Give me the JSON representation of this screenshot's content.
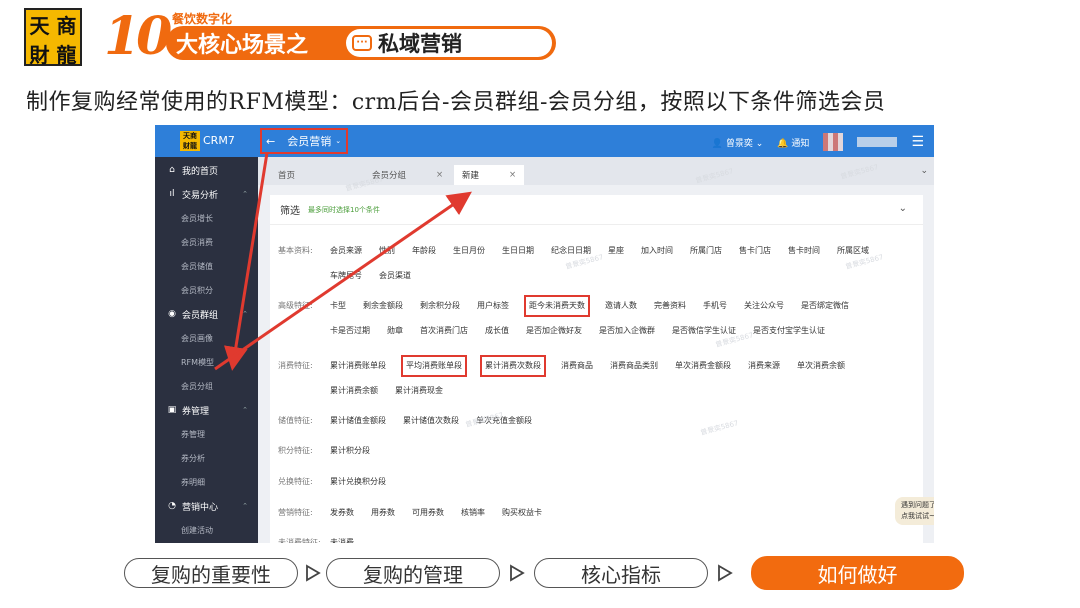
{
  "slide": {
    "logo_chars": [
      "天",
      "商",
      "財",
      "龍"
    ],
    "banner_number": "10",
    "banner_sub": "餐饮数字化",
    "banner_main": "大核心场景之",
    "banner_inner": "私域营销",
    "caption": "制作复购经常使用的RFM模型：crm后台-会员群组-会员分组，按照以下条件筛选会员"
  },
  "app": {
    "logo_text": "天商财龍",
    "name": "CRM7",
    "top_nav": "会员营销",
    "user": "曾景奕",
    "notify": "通知",
    "watermark": "曾景奕5867"
  },
  "sidebar": {
    "items": [
      {
        "label": "我的首页",
        "icon": "home-icon",
        "glyph": "⌂",
        "kind": "top"
      },
      {
        "label": "交易分析",
        "icon": "bar-chart-icon",
        "glyph": "ıl",
        "kind": "top"
      },
      {
        "label": "会员增长",
        "kind": "sub"
      },
      {
        "label": "会员消费",
        "kind": "sub"
      },
      {
        "label": "会员储值",
        "kind": "sub"
      },
      {
        "label": "会员积分",
        "kind": "sub"
      },
      {
        "label": "会员群组",
        "icon": "group-icon",
        "glyph": "◉",
        "kind": "top"
      },
      {
        "label": "会员画像",
        "kind": "sub"
      },
      {
        "label": "RFM模型",
        "kind": "sub"
      },
      {
        "label": "会员分组",
        "kind": "sub"
      },
      {
        "label": "券管理",
        "icon": "coupon-icon",
        "glyph": "▣",
        "kind": "top"
      },
      {
        "label": "券管理",
        "kind": "sub"
      },
      {
        "label": "券分析",
        "kind": "sub"
      },
      {
        "label": "券明细",
        "kind": "sub"
      },
      {
        "label": "营销中心",
        "icon": "pie-icon",
        "glyph": "◔",
        "kind": "top"
      },
      {
        "label": "创建活动",
        "kind": "sub"
      }
    ]
  },
  "tabs": [
    {
      "label": "首页",
      "close": ""
    },
    {
      "label": "会员分组",
      "close": "×"
    },
    {
      "label": "新建",
      "close": "×"
    }
  ],
  "filter": {
    "title": "筛选",
    "hint": "最多同时选择10个条件",
    "groups": [
      {
        "label": "基本资料:",
        "items": [
          "会员来源",
          "性别",
          "年龄段",
          "生日月份",
          "生日日期",
          "纪念日日期",
          "星座",
          "加入时间",
          "所属门店",
          "售卡门店",
          "售卡时间",
          "所属区域",
          "车牌尾号",
          "会员渠道"
        ]
      },
      {
        "label": "高级特征:",
        "items": [
          "卡型",
          "剩余金额段",
          "剩余积分段",
          "用户标签",
          "距今未消费天数",
          "邀请人数",
          "完善资料",
          "手机号",
          "关注公众号",
          "是否绑定微信",
          "卡是否过期",
          "勋章",
          "首次消费门店",
          "成长值",
          "是否加企微好友",
          "是否加入企微群",
          "是否微信学生认证",
          "是否支付宝学生认证"
        ]
      },
      {
        "label": "消费特征:",
        "items": [
          "累计消费账单段",
          "平均消费账单段",
          "累计消费次数段",
          "消费商品",
          "消费商品类别",
          "单次消费金额段",
          "消费来源",
          "单次消费余额",
          "累计消费余额",
          "累计消费现金"
        ]
      },
      {
        "label": "储值特征:",
        "items": [
          "累计储值金额段",
          "累计储值次数段",
          "单次充值金额段"
        ]
      },
      {
        "label": "积分特征:",
        "items": [
          "累计积分段"
        ]
      },
      {
        "label": "兑换特征:",
        "items": [
          "累计兑换积分段"
        ]
      },
      {
        "label": "营销特征:",
        "items": [
          "发券数",
          "用券数",
          "可用券数",
          "核销率",
          "购买权益卡"
        ]
      },
      {
        "label": "未消费特征:",
        "items": [
          "未消费"
        ]
      }
    ],
    "highlighted": [
      "距今未消费天数",
      "平均消费账单段",
      "累计消费次数段"
    ]
  },
  "help": {
    "line1": "遇到问题了?",
    "line2": "点我试试~"
  },
  "bottom_nav": [
    {
      "label": "复购的重要性",
      "active": false
    },
    {
      "label": "复购的管理",
      "active": false
    },
    {
      "label": "核心指标",
      "active": false
    },
    {
      "label": "如何做好",
      "active": true
    }
  ],
  "colors": {
    "brand_orange": "#f06a0f",
    "topbar_blue": "#2e7fd9",
    "sidebar_dark": "#2b3040",
    "highlight_red": "#e03a2f"
  }
}
